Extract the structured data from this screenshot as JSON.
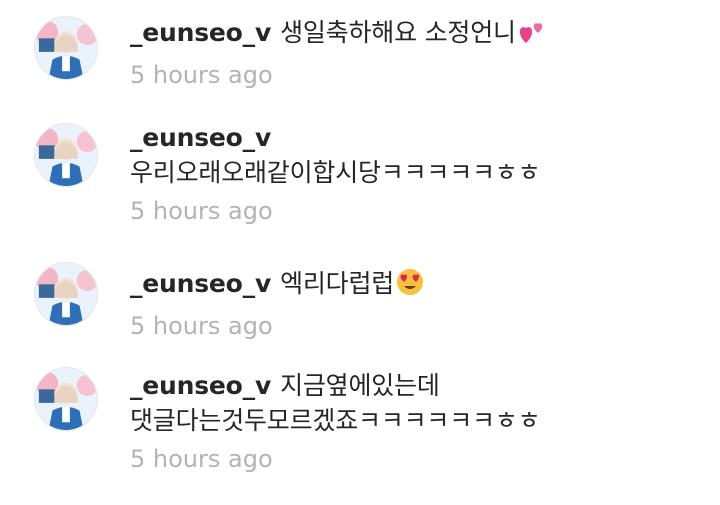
{
  "comments": [
    {
      "username": "_eunseo_v",
      "lines": [
        "생일축하해요 소정언니"
      ],
      "emoji": "two-hearts",
      "time": "5 hours ago"
    },
    {
      "username": "_eunseo_v",
      "lines": [
        "우리오래오래같이합시당ㅋㅋㅋㅋㅋㅎㅎ"
      ],
      "emoji": null,
      "time": "5 hours ago"
    },
    {
      "username": "_eunseo_v",
      "lines": [
        "엑리다럽럽"
      ],
      "emoji": "heart-eyes",
      "time": "5 hours ago"
    },
    {
      "username": "_eunseo_v",
      "lines": [
        "지금옆에있는데",
        "댓글다는것두모르겠죠ㅋㅋㅋㅋㅋㅋㅎㅎ"
      ],
      "emoji": null,
      "time": "5 hours ago"
    }
  ],
  "colors": {
    "text": "#262626",
    "timestamp": "#b3b3b3",
    "avatar_blue": "#2e6fb7",
    "avatar_pink": "#f3b6c7"
  }
}
